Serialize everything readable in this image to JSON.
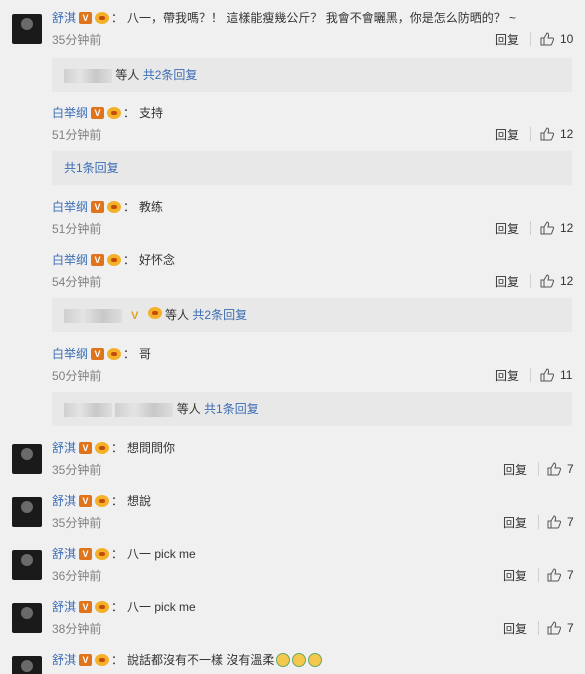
{
  "comments": [
    {
      "user": "舒淇",
      "text": "八一，帶我嗎？！ 這樣能瘦幾公斤？ 我會不會曬黑，你是怎么防晒的？ ~",
      "time": "35分钟前",
      "reply": "回复",
      "likes": "10"
    },
    {
      "user": "白举纲",
      "text": "支持",
      "time": "51分钟前",
      "reply": "回复",
      "likes": "12"
    },
    {
      "user": "白举纲",
      "text": "教练",
      "time": "51分钟前",
      "reply": "回复",
      "likes": "12"
    },
    {
      "user": "白举纲",
      "text": "好怀念",
      "time": "54分钟前",
      "reply": "回复",
      "likes": "12"
    },
    {
      "user": "白举纲",
      "text": "哥",
      "time": "50分钟前",
      "reply": "回复",
      "likes": "11"
    },
    {
      "user": "舒淇",
      "text": "想問問你",
      "time": "35分钟前",
      "reply": "回复",
      "likes": "7"
    },
    {
      "user": "舒淇",
      "text": "想說",
      "time": "35分钟前",
      "reply": "回复",
      "likes": "7"
    },
    {
      "user": "舒淇",
      "text": "八一 pick me",
      "time": "36分钟前",
      "reply": "回复",
      "likes": "7"
    },
    {
      "user": "舒淇",
      "text": "八一 pick me",
      "time": "38分钟前",
      "reply": "回复",
      "likes": "7"
    },
    {
      "user": "舒淇",
      "text": "說話都沒有不一樣 沒有溫柔",
      "time": "",
      "reply": "",
      "likes": ""
    }
  ],
  "sub_replies": [
    {
      "prefix": "等人",
      "count": "共2条回复"
    },
    {
      "prefix": "",
      "count": "共1条回复"
    },
    {
      "prefix": "等人",
      "count": "共2条回复"
    },
    {
      "prefix": "等人",
      "count": "共1条回复"
    }
  ],
  "badges": {
    "v": "V"
  },
  "colors": {
    "username": "#3c6db4",
    "vbadge": "#e0741c",
    "fan": "#f5b02a",
    "timestamp": "#808080",
    "subbox": "#e8e8e8",
    "bg": "#f0f0f0"
  },
  "icons": [
    "thumb-up-icon",
    "v-verified-icon",
    "fan-badge-icon",
    "crying-emoji-icon"
  ]
}
